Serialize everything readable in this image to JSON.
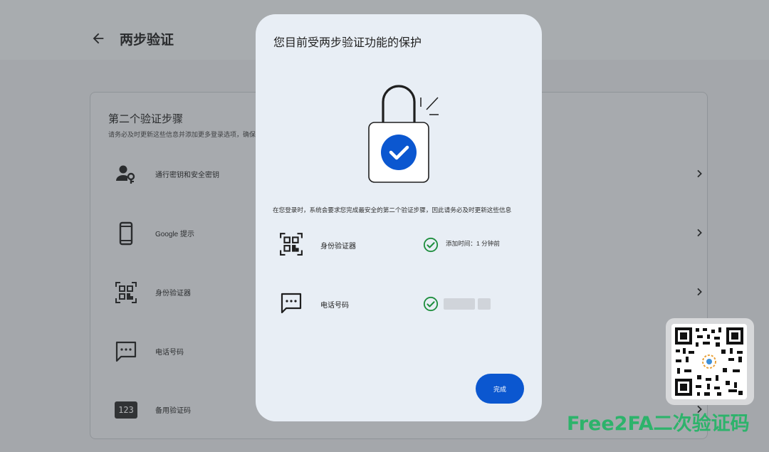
{
  "page": {
    "title": "两步验证",
    "back_icon": "arrow-back-icon"
  },
  "card": {
    "title": "第二个验证步骤",
    "subtitle": "请务必及时更新这些信息并添加更多登录选项，确保",
    "methods": [
      {
        "label": "通行密钥和安全密钥",
        "icon": "passkey-icon"
      },
      {
        "label": "Google 提示",
        "icon": "phone-icon"
      },
      {
        "label": "身份验证器",
        "icon": "qr-icon"
      },
      {
        "label": "电话号码",
        "icon": "message-icon"
      },
      {
        "label": "备用验证码",
        "icon": "backup-code-icon"
      }
    ]
  },
  "dialog": {
    "title": "您目前受两步验证功能的保护",
    "description": "在您登录时，系统会要求您完成最安全的第二个验证步骤，因此请务必及时更新这些信息",
    "rows": [
      {
        "label": "身份验证器",
        "status": "添加时间：1 分钟前",
        "icon": "qr-icon"
      },
      {
        "label": "电话号码",
        "status": "",
        "icon": "message-icon"
      }
    ],
    "done_label": "完成"
  },
  "backup_icon_text": "123",
  "watermark": "Free2FA二次验证码",
  "colors": {
    "primary": "#0b57d0",
    "success": "#1e8e3e",
    "watermark": "#2db36b"
  }
}
